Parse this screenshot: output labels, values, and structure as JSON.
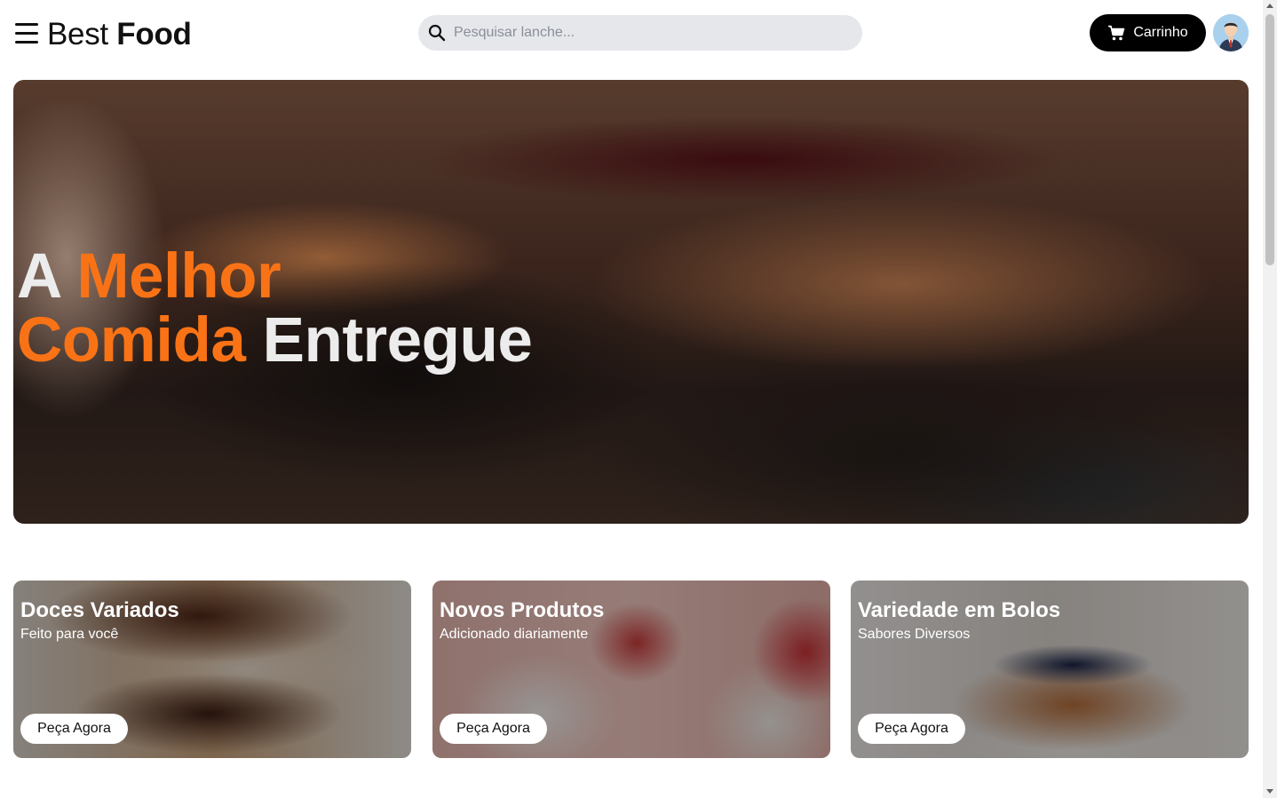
{
  "header": {
    "menu_icon": "hamburger-menu-icon",
    "logo": {
      "light": "Best",
      "bold": "Food"
    },
    "search": {
      "placeholder": "Pesquisar lanche...",
      "value": "",
      "icon": "search-icon"
    },
    "cart": {
      "label": "Carrinho",
      "icon": "cart-icon"
    },
    "avatar": {
      "icon": "user-avatar-icon"
    }
  },
  "hero": {
    "title_parts": [
      "A",
      "Melhor",
      "Comida",
      "Entregue"
    ],
    "colors": {
      "white": "#ececec",
      "accent": "#f97316"
    }
  },
  "cards": [
    {
      "title": "Doces Variados",
      "subtitle": "Feito para você",
      "button": "Peça Agora"
    },
    {
      "title": "Novos Produtos",
      "subtitle": "Adicionado diariamente",
      "button": "Peça Agora"
    },
    {
      "title": "Variedade em Bolos",
      "subtitle": "Sabores Diversos",
      "button": "Peça Agora"
    }
  ],
  "theme": {
    "primary": "#000000",
    "accent": "#f97316",
    "search_bg": "#e5e7eb"
  }
}
